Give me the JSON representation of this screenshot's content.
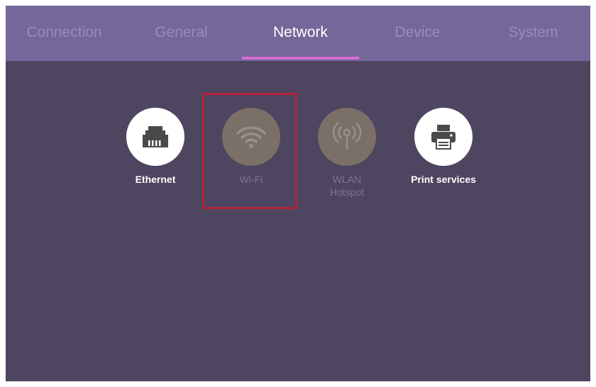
{
  "tabs": [
    {
      "label": "Connection",
      "active": false
    },
    {
      "label": "General",
      "active": false
    },
    {
      "label": "Network",
      "active": true
    },
    {
      "label": "Device",
      "active": false
    },
    {
      "label": "System",
      "active": false
    }
  ],
  "options": [
    {
      "label": "Ethernet",
      "icon": "ethernet-port-icon",
      "enabled": true
    },
    {
      "label": "Wi-Fi",
      "icon": "wifi-icon",
      "enabled": false,
      "highlighted": true
    },
    {
      "label": "WLAN Hotspot",
      "label_line1": "WLAN",
      "label_line2": "Hotspot",
      "icon": "hotspot-icon",
      "enabled": false
    },
    {
      "label": "Print services",
      "icon": "printer-icon",
      "enabled": true
    }
  ],
  "colors": {
    "background": "#4e4560",
    "tab_bar": "#74679a",
    "tab_indicator": "#d86cd6",
    "highlight_border": "#b3233a",
    "disabled_circle": "#7a7068"
  }
}
